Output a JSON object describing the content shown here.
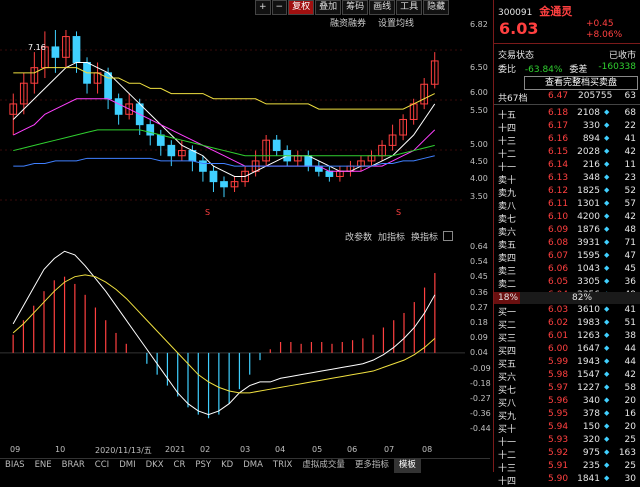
{
  "toolbar": {
    "buttons": [
      "+",
      "−",
      "复权",
      "叠加",
      "筹码",
      "画线",
      "工具",
      "隐藏"
    ],
    "active": "复权",
    "sub": [
      "融资融券",
      "设置均线"
    ]
  },
  "price_axis": [
    "6.82",
    "6.50",
    "6.00",
    "5.50",
    "5.00",
    "4.50",
    "4.00",
    "3.50"
  ],
  "macd_axis": [
    "0.64",
    "0.54",
    "0.45",
    "0.36",
    "0.27",
    "0.18",
    "0.09",
    "0.04",
    "-0.09",
    "-0.18",
    "-0.27",
    "-0.36",
    "-0.44"
  ],
  "high_marker": "7.16",
  "indicator_tools": [
    "改参数",
    "加指标",
    "换指标"
  ],
  "x_axis": [
    "09",
    "10",
    "2020/11/13/五",
    "2021",
    "02",
    "03",
    "04",
    "05",
    "06",
    "07",
    "08"
  ],
  "bottom_tabs": [
    "BIAS",
    "ENE",
    "BRAR",
    "CCI",
    "DMI",
    "DKX",
    "CR",
    "PSY",
    "KD",
    "DMA",
    "TRIX",
    "虚拟成交量",
    "更多指标",
    "模板"
  ],
  "active_tab": "模板",
  "quote": {
    "code": "300091",
    "name": "金通灵",
    "price": "6.03",
    "change": "+0.45",
    "change_pct": "+8.06%",
    "status_label": "交易状态",
    "status_value": "已收市",
    "wb_label": "委比",
    "wb_value": "-63.84%",
    "wc_label": "委差",
    "wc_value": "-160338",
    "full_book": "查看完整档买卖盘",
    "total_label": "共67档",
    "total_price": "6.47",
    "total_vol": "205755",
    "total_count": "63"
  },
  "sells": [
    {
      "label": "十五",
      "price": "6.18",
      "vol": "2108",
      "cnt": "68"
    },
    {
      "label": "十四",
      "price": "6.17",
      "vol": "330",
      "cnt": "22"
    },
    {
      "label": "十三",
      "price": "6.16",
      "vol": "894",
      "cnt": "41"
    },
    {
      "label": "十二",
      "price": "6.15",
      "vol": "2028",
      "cnt": "42"
    },
    {
      "label": "十一",
      "price": "6.14",
      "price_raw": "6.14",
      "vol": "216",
      "cnt": "11"
    },
    {
      "label": "卖十",
      "price": "6.13",
      "vol": "348",
      "cnt": "23"
    },
    {
      "label": "卖九",
      "price": "6.12",
      "vol": "1825",
      "cnt": "52"
    },
    {
      "label": "卖八",
      "price": "6.11",
      "vol": "1301",
      "cnt": "57"
    },
    {
      "label": "卖七",
      "price": "6.10",
      "vol": "4200",
      "cnt": "42"
    },
    {
      "label": "卖六",
      "price": "6.09",
      "vol": "1876",
      "cnt": "48"
    },
    {
      "label": "卖五",
      "price": "6.08",
      "vol": "3931",
      "cnt": "71"
    },
    {
      "label": "卖四",
      "price": "6.07",
      "vol": "1595",
      "cnt": "47"
    },
    {
      "label": "卖三",
      "price": "6.06",
      "vol": "1043",
      "cnt": "45"
    },
    {
      "label": "卖二",
      "price": "6.05",
      "vol": "3305",
      "cnt": "36"
    },
    {
      "label": "卖一",
      "price": "6.04",
      "vol": "2356",
      "cnt": "49"
    }
  ],
  "ratio": {
    "left": "18%",
    "right": "82%"
  },
  "buys": [
    {
      "label": "买一",
      "price": "6.03",
      "vol": "3610",
      "cnt": "41"
    },
    {
      "label": "买二",
      "price": "6.02",
      "vol": "1983",
      "cnt": "51"
    },
    {
      "label": "买三",
      "price": "6.01",
      "vol": "1263",
      "cnt": "38"
    },
    {
      "label": "买四",
      "price": "6.00",
      "vol": "1647",
      "cnt": "44"
    },
    {
      "label": "买五",
      "price": "5.99",
      "vol": "1943",
      "cnt": "44"
    },
    {
      "label": "买六",
      "price": "5.98",
      "vol": "1547",
      "cnt": "42"
    },
    {
      "label": "买七",
      "price": "5.97",
      "vol": "1227",
      "cnt": "58"
    },
    {
      "label": "买八",
      "price": "5.96",
      "vol": "340",
      "cnt": "20"
    },
    {
      "label": "买九",
      "price": "5.95",
      "vol": "378",
      "cnt": "16"
    },
    {
      "label": "买十",
      "price": "5.94",
      "vol": "150",
      "cnt": "20"
    },
    {
      "label": "十一",
      "price": "5.93",
      "vol": "320",
      "cnt": "25"
    },
    {
      "label": "十二",
      "price": "5.92",
      "vol": "975",
      "cnt": "163"
    },
    {
      "label": "十三",
      "price": "5.91",
      "vol": "235",
      "cnt": "25"
    },
    {
      "label": "十四",
      "price": "5.90",
      "vol": "1841",
      "cnt": "30"
    }
  ],
  "colors": {
    "up": "#ff4040",
    "down": "#40d0ff",
    "ma5": "#ffffff",
    "ma10": "#f0e040",
    "ma20": "#ff40ff",
    "ma60": "#30d030",
    "ma120": "#4080ff",
    "dif": "#ffffff",
    "dea": "#f0e040"
  }
}
